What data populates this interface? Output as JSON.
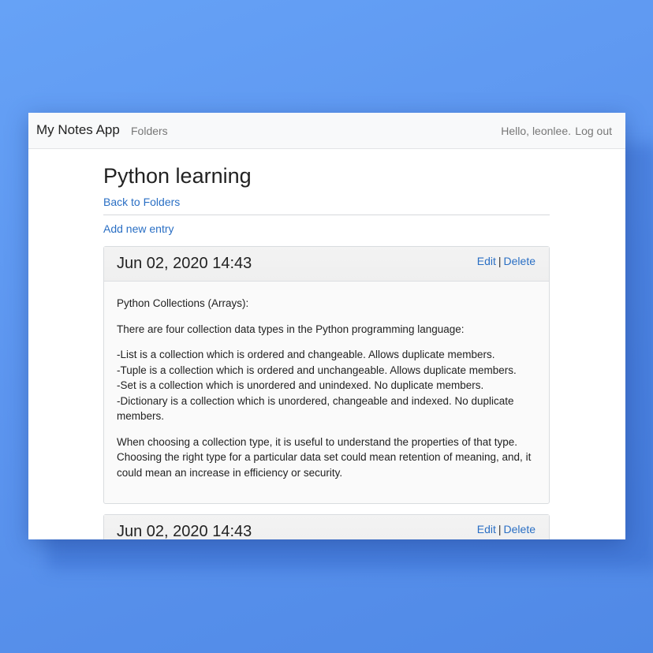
{
  "navbar": {
    "brand": "My Notes App",
    "folders_link": "Folders",
    "greeting": "Hello, leonlee.",
    "logout_link": "Log out"
  },
  "page": {
    "title": "Python learning",
    "back_link": "Back to Folders",
    "add_entry_link": "Add new entry"
  },
  "entries": [
    {
      "date": "Jun 02, 2020 14:43",
      "edit_label": "Edit",
      "separator": "|",
      "delete_label": "Delete",
      "paragraphs": [
        "Python Collections (Arrays):",
        "There are four collection data types in the Python programming language:",
        "-List is a collection which is ordered and changeable. Allows duplicate members.\n-Tuple is a collection which is ordered and unchangeable. Allows duplicate members.\n-Set is a collection which is unordered and unindexed. No duplicate members.\n-Dictionary is a collection which is unordered, changeable and indexed. No duplicate members.",
        "When choosing a collection type, it is useful to understand the properties of that type. Choosing the right type for a particular data set could mean retention of meaning, and, it could mean an increase in efficiency or security."
      ]
    },
    {
      "date": "Jun 02, 2020 14:43",
      "edit_label": "Edit",
      "separator": "|",
      "delete_label": "Delete"
    }
  ]
}
